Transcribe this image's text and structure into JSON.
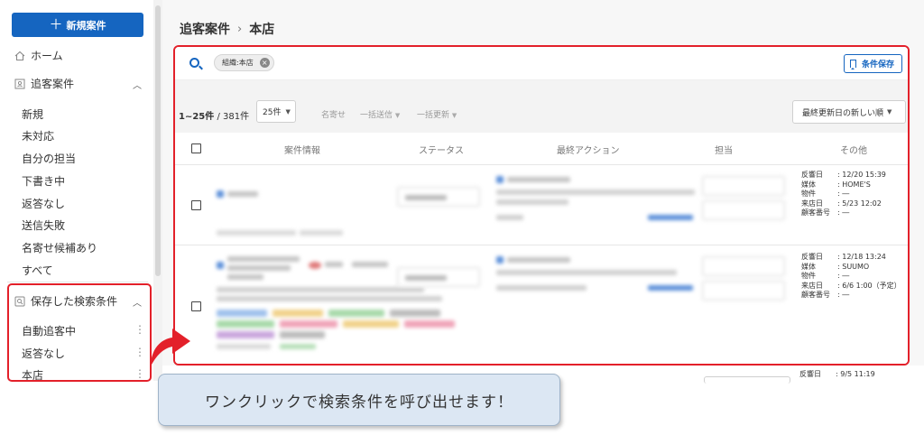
{
  "sidebar": {
    "new_button": "新規案件",
    "home": "ホーム",
    "section_label": "追客案件",
    "items": [
      "新規",
      "未対応",
      "自分の担当",
      "下書き中",
      "返答なし",
      "送信失敗",
      "名寄せ候補あり",
      "すべて"
    ],
    "saved_section_label": "保存した検索条件",
    "saved_items": [
      "自動追客中",
      "返答なし",
      "本店"
    ]
  },
  "header": {
    "crumb_parent": "追客案件",
    "crumb_sep": "›",
    "crumb_current": "本店"
  },
  "search": {
    "chip": "組織:本店",
    "save_button": "条件保存"
  },
  "toolbar": {
    "range": "1~25件",
    "total": "/ 381件",
    "per_page": "25件",
    "merge": "名寄せ",
    "bulk_send": "一括送信",
    "bulk_update": "一括更新",
    "sort": "最終更新日の新しい順"
  },
  "table": {
    "headers": [
      "案件情報",
      "ステータス",
      "最終アクション",
      "担当",
      "その他"
    ],
    "rows": [
      {
        "other": [
          {
            "k": "反響日",
            "v": ": 12/20 15:39"
          },
          {
            "k": "媒体",
            "v": ": HOME'S"
          },
          {
            "k": "物件",
            "v": ": ―"
          },
          {
            "k": "来店日",
            "v": ": 5/23 12:02"
          },
          {
            "k": "顧客番号",
            "v": ": ―"
          }
        ]
      },
      {
        "other": [
          {
            "k": "反響日",
            "v": ": 12/18 13:24"
          },
          {
            "k": "媒体",
            "v": ": SUUMO"
          },
          {
            "k": "物件",
            "v": ": ―"
          },
          {
            "k": "来店日",
            "v": ": 6/6 1:00（予定）"
          },
          {
            "k": "顧客番号",
            "v": ": ―"
          }
        ]
      }
    ],
    "next_row_other": {
      "k": "反響日",
      "v": ": 9/5 11:19"
    }
  },
  "callout": {
    "text": "ワンクリックで検索条件を呼び出せます！"
  },
  "colors": {
    "primary": "#1565c0",
    "highlight": "#e3202a",
    "callout_bg": "#dce7f3"
  }
}
